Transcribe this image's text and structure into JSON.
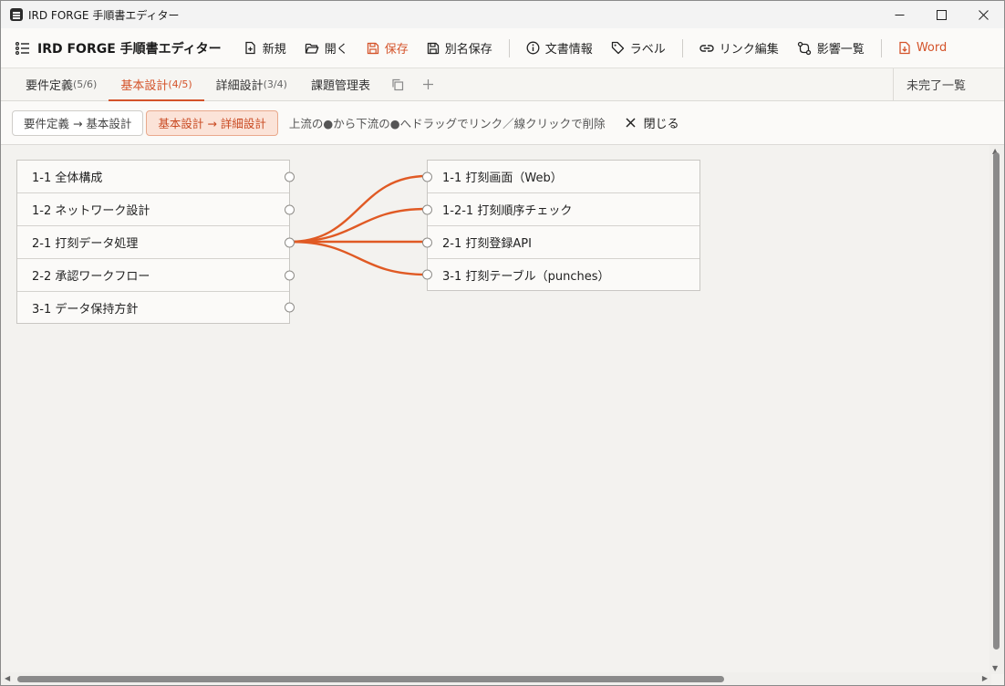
{
  "window": {
    "title": "IRD FORGE 手順書エディター"
  },
  "toolbar": {
    "brand": "IRD FORGE 手順書エディター",
    "new": "新規",
    "open": "開く",
    "save": "保存",
    "save_as": "別名保存",
    "doc_info": "文書情報",
    "label": "ラベル",
    "link_edit": "リンク編集",
    "impact_list": "影響一覧",
    "word": "Word"
  },
  "tabs": [
    {
      "label": "要件定義",
      "count": "(5/6)"
    },
    {
      "label": "基本設計",
      "count": "(4/5)"
    },
    {
      "label": "詳細設計",
      "count": "(3/4)"
    },
    {
      "label": "課題管理表",
      "count": ""
    }
  ],
  "tabs_right": "未完了一覧",
  "linkbar": {
    "pair1": "要件定義 → 基本設計",
    "pair2": "基本設計 → 詳細設計",
    "hint": "上流の●から下流の●へドラッグでリンク／線クリックで削除",
    "close": "閉じる"
  },
  "upstream": [
    "1-1 全体構成",
    "1-2 ネットワーク設計",
    "2-1 打刻データ処理",
    "2-2 承認ワークフロー",
    "3-1 データ保持方針"
  ],
  "downstream": [
    "1-1 打刻画面（Web）",
    "1-2-1 打刻順序チェック",
    "2-1 打刻登録API",
    "3-1 打刻テーブル（punches）"
  ],
  "links": [
    {
      "from": 2,
      "to": 0
    },
    {
      "from": 2,
      "to": 1
    },
    {
      "from": 2,
      "to": 2
    },
    {
      "from": 2,
      "to": 3
    }
  ],
  "colors": {
    "accent": "#d4532a",
    "link": "#e05a24"
  }
}
